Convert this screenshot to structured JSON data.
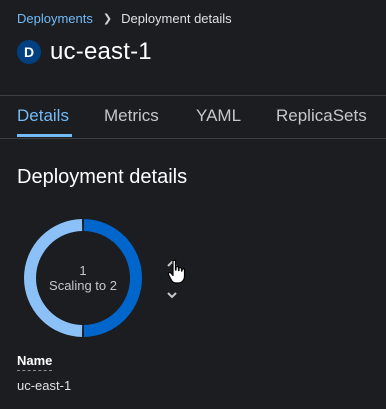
{
  "breadcrumb": {
    "parent": "Deployments",
    "current": "Deployment details"
  },
  "resource": {
    "kind_badge": "D",
    "name": "uc-east-1"
  },
  "tabs": [
    {
      "label": "Details",
      "active": true
    },
    {
      "label": "Metrics",
      "active": false
    },
    {
      "label": "YAML",
      "active": false
    },
    {
      "label": "ReplicaSets",
      "active": false
    }
  ],
  "section": {
    "heading": "Deployment details"
  },
  "pod_ring": {
    "count": "1",
    "status": "Scaling to 2",
    "segments": [
      {
        "fraction": 0.5,
        "color": "#0066cc"
      },
      {
        "fraction": 0.5,
        "color": "#8bc1f7"
      }
    ]
  },
  "fields": {
    "name_label": "Name",
    "name_value": "uc-east-1"
  },
  "colors": {
    "background": "#1b1d21",
    "link": "#73bcf7",
    "badge": "#004080"
  },
  "icons": {
    "breadcrumb_separator": "chevron-right-icon",
    "scale_up": "chevron-up-icon",
    "scale_down": "chevron-down-icon",
    "cursor": "hand-pointer-icon"
  }
}
